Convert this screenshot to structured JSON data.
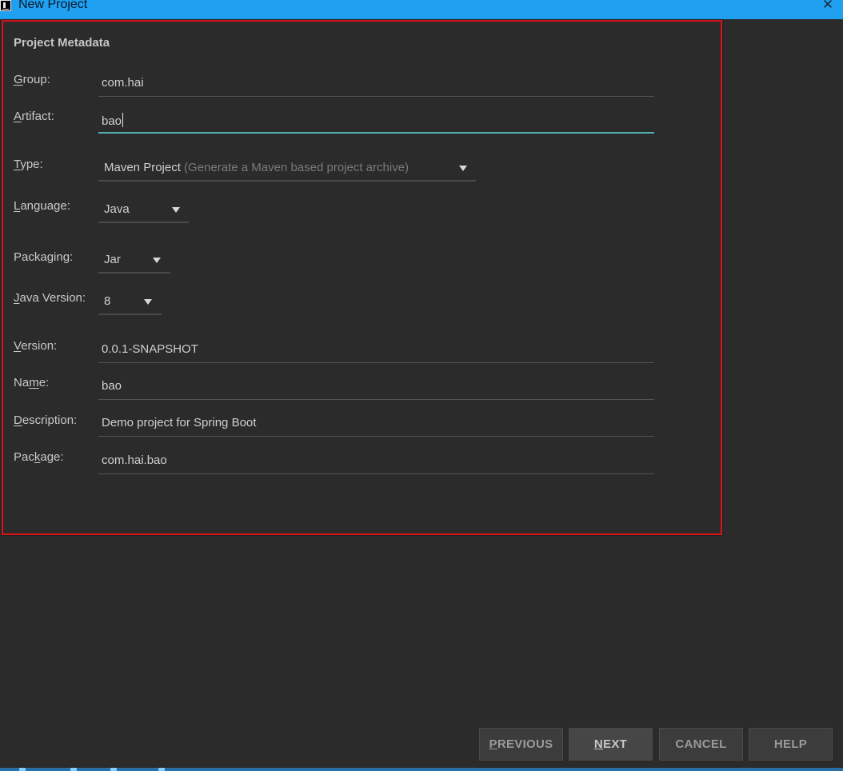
{
  "window": {
    "title": "New Project",
    "close_icon": "close-icon",
    "app_icon": "intellij-idea-icon"
  },
  "section": {
    "title": "Project Metadata"
  },
  "fields": {
    "group": {
      "label": "Group:",
      "mnemonic": "G",
      "rest": "roup:",
      "value": "com.hai"
    },
    "artifact": {
      "label": "Artifact:",
      "mnemonic": "A",
      "rest": "rtifact:",
      "value": "bao"
    },
    "type": {
      "label": "Type:",
      "mnemonic": "T",
      "rest": "ype:",
      "value": "Maven Project",
      "hint": "(Generate a Maven based project archive)"
    },
    "language": {
      "label": "Language:",
      "mnemonic": "L",
      "rest": "anguage:",
      "value": "Java"
    },
    "packaging": {
      "label": "Packaging:",
      "value": "Jar"
    },
    "java_version": {
      "label": "Java Version:",
      "mnemonic": "J",
      "rest": "ava Version:",
      "value": "8"
    },
    "version": {
      "label": "Version:",
      "mnemonic": "V",
      "rest": "ersion:",
      "value": "0.0.1-SNAPSHOT"
    },
    "name": {
      "label": "Name:",
      "pre": "Na",
      "mnemonic": "m",
      "rest": "e:",
      "value": "bao"
    },
    "description": {
      "label": "Description:",
      "mnemonic": "D",
      "rest": "escription:",
      "value": "Demo project for Spring Boot"
    },
    "package": {
      "label": "Package:",
      "pre": "Pac",
      "mnemonic": "k",
      "rest": "age:",
      "value": "com.hai.bao"
    }
  },
  "buttons": {
    "previous": {
      "label": "PREVIOUS",
      "mnemonic": "P",
      "rest": "REVIOUS"
    },
    "next": {
      "label": "NEXT",
      "mnemonic": "N",
      "rest": "EXT"
    },
    "cancel": {
      "label": "CANCEL"
    },
    "help": {
      "label": "HELP"
    }
  },
  "colors": {
    "titlebar": "#1fa0f0",
    "background": "#2b2b2b",
    "highlight_border": "#d8131b",
    "focus_underline": "#52b3b0"
  }
}
